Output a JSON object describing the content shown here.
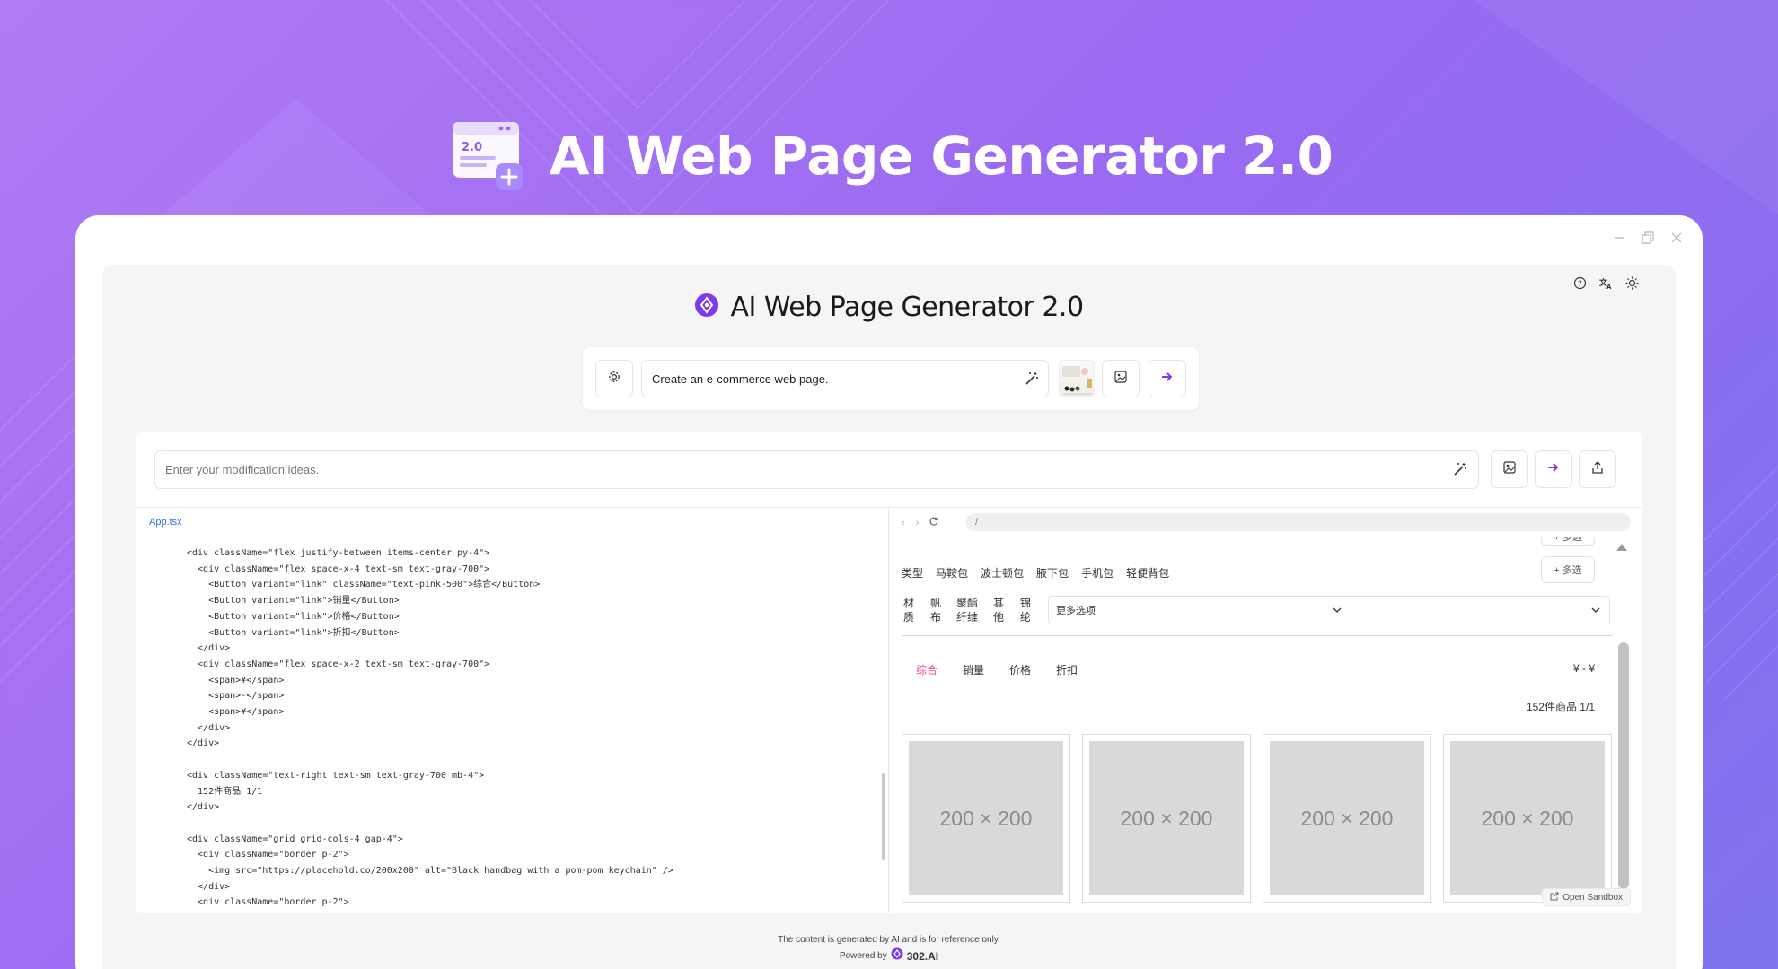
{
  "hero": {
    "title": "AI Web Page Generator 2.0",
    "icon_badge": "2.0"
  },
  "app": {
    "title": "AI Web Page Generator 2.0",
    "prompt": {
      "value": "Create an e-commerce web page."
    },
    "modify": {
      "placeholder": "Enter your modification ideas."
    },
    "file_tab": "App.tsx",
    "code_lines": [
      {
        "indent": 0,
        "text": "<div className=\"flex justify-between items-center py-4\">"
      },
      {
        "indent": 1,
        "text": "<div className=\"flex space-x-4 text-sm text-gray-700\">"
      },
      {
        "indent": 2,
        "text": "<Button variant=\"link\" className=\"text-pink-500\">综合</Button>"
      },
      {
        "indent": 2,
        "text": "<Button variant=\"link\">销量</Button>"
      },
      {
        "indent": 2,
        "text": "<Button variant=\"link\">价格</Button>"
      },
      {
        "indent": 2,
        "text": "<Button variant=\"link\">折扣</Button>"
      },
      {
        "indent": 1,
        "text": "</div>"
      },
      {
        "indent": 1,
        "text": "<div className=\"flex space-x-2 text-sm text-gray-700\">"
      },
      {
        "indent": 2,
        "text": "<span>¥</span>"
      },
      {
        "indent": 2,
        "text": "<span>-</span>"
      },
      {
        "indent": 2,
        "text": "<span>¥</span>"
      },
      {
        "indent": 1,
        "text": "</div>"
      },
      {
        "indent": 0,
        "text": "</div>"
      },
      {
        "indent": 0,
        "text": ""
      },
      {
        "indent": 0,
        "text": "<div className=\"text-right text-sm text-gray-700 mb-4\">"
      },
      {
        "indent": 1,
        "text": "152件商品 1/1"
      },
      {
        "indent": 0,
        "text": "</div>"
      },
      {
        "indent": 0,
        "text": ""
      },
      {
        "indent": 0,
        "text": "<div className=\"grid grid-cols-4 gap-4\">"
      },
      {
        "indent": 1,
        "text": "<div className=\"border p-2\">"
      },
      {
        "indent": 2,
        "text": "<img src=\"https://placehold.co/200x200\" alt=\"Black handbag with a pom-pom keychain\" />"
      },
      {
        "indent": 1,
        "text": "</div>"
      },
      {
        "indent": 1,
        "text": "<div className=\"border p-2\">"
      }
    ],
    "preview": {
      "url": "/",
      "categories": [
        "类型",
        "马鞍包",
        "波士顿包",
        "腋下包",
        "手机包",
        "轻便背包"
      ],
      "more_label": "+ 多选",
      "materials": [
        "材质",
        "帆布",
        "聚酯纤维",
        "其他",
        "锦纶"
      ],
      "select_value": "更多选项",
      "sort_tabs": [
        "综合",
        "销量",
        "价格",
        "折扣"
      ],
      "price_range": "¥ - ¥",
      "count": "152件商品 1/1",
      "placeholder_label": "200 × 200",
      "open_sandbox": "Open Sandbox"
    },
    "footer": {
      "line1": "The content is generated by AI and is for reference only.",
      "powered_by": "Powered by",
      "brand": "302.AI"
    }
  },
  "colors": {
    "accent": "#7c3aed",
    "pink": "#ec4899",
    "link": "#2f6fd6"
  }
}
